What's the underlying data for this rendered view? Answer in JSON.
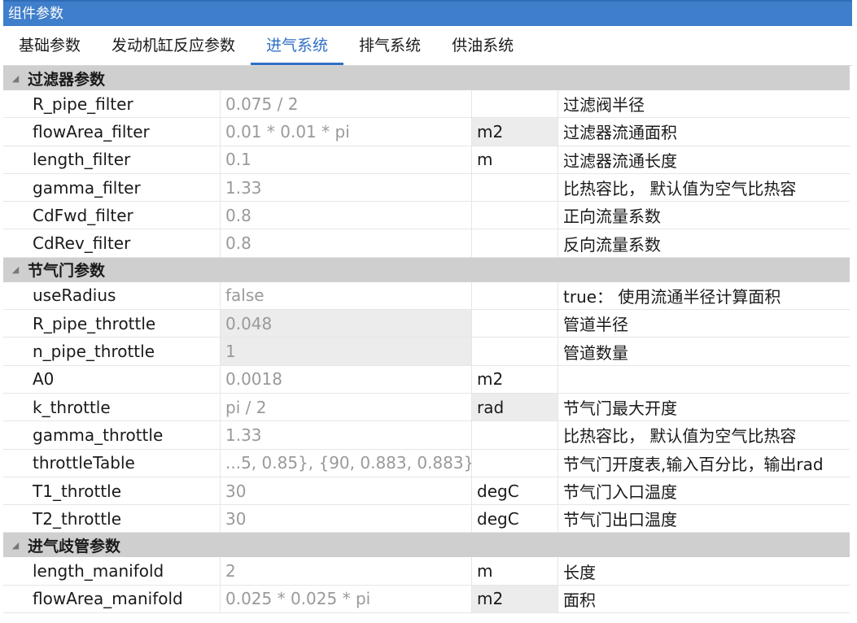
{
  "title": "组件参数",
  "tabs": [
    {
      "label": "基础参数",
      "active": false
    },
    {
      "label": "发动机缸反应参数",
      "active": false
    },
    {
      "label": "进气系统",
      "active": true
    },
    {
      "label": "排气系统",
      "active": false
    },
    {
      "label": "供油系统",
      "active": false
    }
  ],
  "groups": [
    {
      "name": "过滤器参数",
      "rows": [
        {
          "name": "R_pipe_filter",
          "value": "0.075 / 2",
          "unit": "",
          "desc": "过滤阀半径"
        },
        {
          "name": "flowArea_filter",
          "value": "0.01 * 0.01 * pi",
          "unit": "m2",
          "desc": "过滤器流通面积"
        },
        {
          "name": "length_filter",
          "value": "0.1",
          "unit": "m",
          "desc": "过滤器流通长度"
        },
        {
          "name": "gamma_filter",
          "value": "1.33",
          "unit": "",
          "desc": "比热容比， 默认值为空气比热容"
        },
        {
          "name": "CdFwd_filter",
          "value": "0.8",
          "unit": "",
          "desc": "正向流量系数"
        },
        {
          "name": "CdRev_filter",
          "value": "0.8",
          "unit": "",
          "desc": "反向流量系数"
        }
      ]
    },
    {
      "name": "节气门参数",
      "rows": [
        {
          "name": "useRadius",
          "value": "false",
          "unit": "",
          "desc": "true： 使用流通半径计算面积"
        },
        {
          "name": "R_pipe_throttle",
          "value": "0.048",
          "unit": "",
          "desc": "管道半径"
        },
        {
          "name": "n_pipe_throttle",
          "value": "1",
          "unit": "",
          "desc": "管道数量"
        },
        {
          "name": "A0",
          "value": "0.0018",
          "unit": "m2",
          "desc": ""
        },
        {
          "name": "k_throttle",
          "value": "pi / 2",
          "unit": "rad",
          "desc": "节气门最大开度"
        },
        {
          "name": "gamma_throttle",
          "value": "1.33",
          "unit": "",
          "desc": "比热容比， 默认值为空气比热容"
        },
        {
          "name": "throttleTable",
          "value": "...5, 0.85}, {90, 0.883, 0.883}}",
          "unit": "",
          "desc": "节气门开度表,输入百分比，输出rad"
        },
        {
          "name": "T1_throttle",
          "value": "30",
          "unit": "degC",
          "desc": "节气门入口温度"
        },
        {
          "name": "T2_throttle",
          "value": "30",
          "unit": "degC",
          "desc": "节气门出口温度"
        }
      ]
    },
    {
      "name": "进气歧管参数",
      "rows": [
        {
          "name": "length_manifold",
          "value": "2",
          "unit": "m",
          "desc": "长度"
        },
        {
          "name": "flowArea_manifold",
          "value": "0.025 * 0.025 * pi",
          "unit": "m2",
          "desc": "面积"
        }
      ]
    }
  ]
}
